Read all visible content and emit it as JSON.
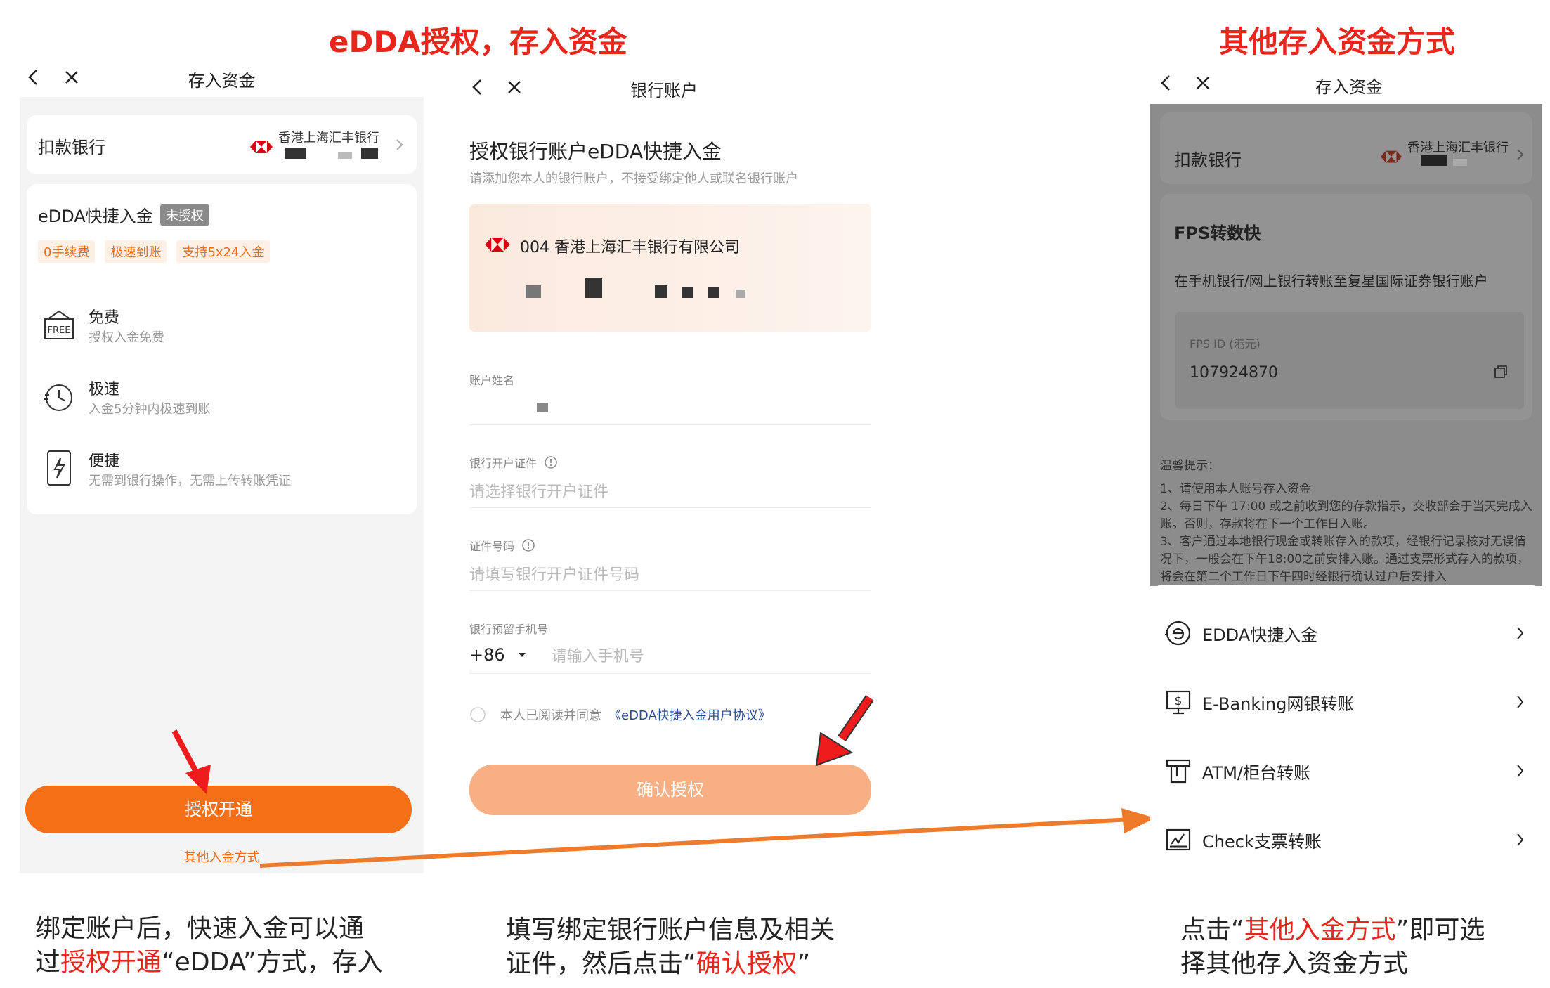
{
  "headings": {
    "left": "eDDA授权，存入资金",
    "right": "其他存入资金方式"
  },
  "screen1": {
    "nav_title": "存入资金",
    "bank_label": "扣款银行",
    "bank_name": "香港上海汇丰银行",
    "edda_title": "eDDA快捷入金",
    "edda_badge": "未授权",
    "tags": [
      "0手续费",
      "极速到账",
      "支持5x24入金"
    ],
    "features": [
      {
        "title": "免费",
        "desc": "授权入金免费",
        "icon": "free-icon"
      },
      {
        "title": "极速",
        "desc": "入金5分钟内极速到账",
        "icon": "clock-icon"
      },
      {
        "title": "便捷",
        "desc": "无需到银行操作，无需上传转账凭证",
        "icon": "phone-lightning-icon"
      }
    ],
    "authorize_button": "授权开通",
    "other_methods_link": "其他入金方式"
  },
  "screen2": {
    "nav_title": "银行账户",
    "heading": "授权银行账户eDDA快捷入金",
    "subheading": "请添加您本人的银行账户，不接受绑定他人或联名银行账户",
    "bank_card_name": "004 香港上海汇丰银行有限公司",
    "account_name_label": "账户姓名",
    "id_type_label": "银行开户证件",
    "id_type_placeholder": "请选择银行开户证件",
    "id_number_label": "证件号码",
    "id_number_placeholder": "请填写银行开户证件号码",
    "phone_label": "银行预留手机号",
    "phone_prefix": "+86",
    "phone_placeholder": "请输入手机号",
    "agreement_prefix": "本人已阅读并同意",
    "agreement_link": "《eDDA快捷入金用户协议》",
    "confirm_button": "确认授权"
  },
  "screen3": {
    "nav_title": "存入资金",
    "bank_label": "扣款银行",
    "bank_name": "香港上海汇丰银行",
    "fps_title": "FPS转数快",
    "fps_desc": "在手机银行/网上银行转账至复星国际证券银行账户",
    "fps_id_label": "FPS ID (港元)",
    "fps_id_value": "107924870",
    "tips_title": "温馨提示：",
    "tips": [
      "1、请使用本人账号存入资金",
      "2、每日下午 17:00 或之前收到您的存款指示，交收部会于当天完成入账。否则，存款将在下一个工作日入账。",
      "3、客户通过本地银行现金或转账存入的款项，经银行记录核对无误情况下，一般会在下午18:00之前安排入账。通过支票形式存入的款项，将会在第二个工作日下午四时经银行确认过户后安排入"
    ],
    "methods": [
      {
        "label": "EDDA快捷入金",
        "icon": "edda-icon"
      },
      {
        "label": "E-Banking网银转账",
        "icon": "ebanking-icon"
      },
      {
        "label": "ATM/柜台转账",
        "icon": "atm-icon"
      },
      {
        "label": "Check支票转账",
        "icon": "check-icon"
      }
    ]
  },
  "captions": {
    "c1_a": "绑定账户后，快速入金可以通",
    "c1_b1": "过",
    "c1_b2": "授权开通",
    "c1_b3": "“eDDA”方式，存入",
    "c2_a": "填写绑定银行账户信息及相关",
    "c2_b1": "证件，然后点击“",
    "c2_b2": "确认授权",
    "c2_b3": "”",
    "c3_a1": "点击“",
    "c3_a2": "其他入金方式",
    "c3_a3": "”即可选",
    "c3_b": "择其他存入资金方式"
  },
  "colors": {
    "accent_orange": "#f56f16",
    "annotation_red": "#e8261c",
    "hsbc_red": "#db0011"
  }
}
